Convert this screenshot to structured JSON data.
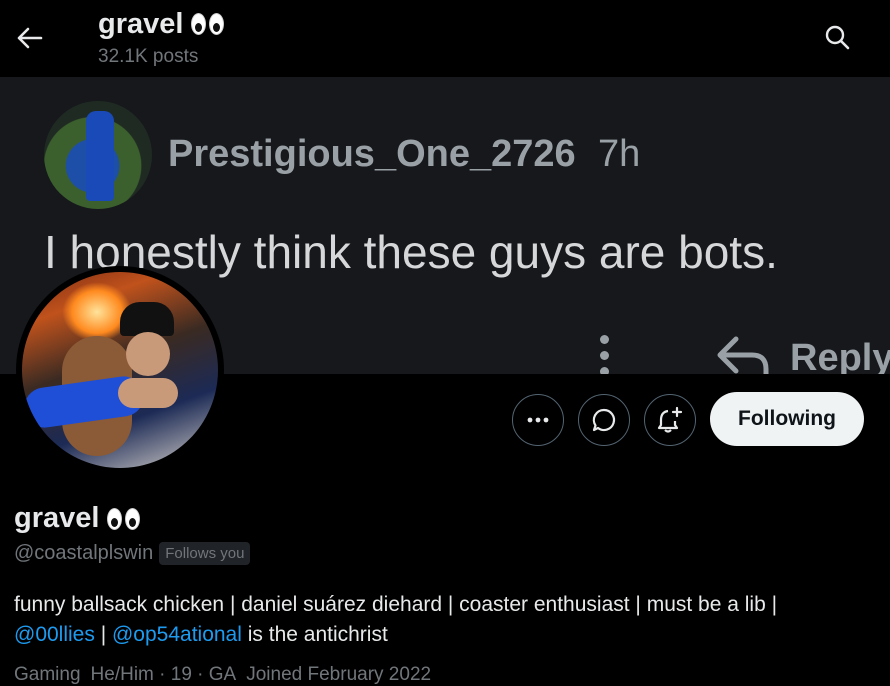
{
  "header": {
    "title": "gravel",
    "title_emoji": "eyes-emoji",
    "posts_count": "32.1K posts"
  },
  "banner": {
    "username": "Prestigious_One_2726",
    "time": "7h",
    "text": "I honestly think these guys are bots.",
    "reply_label": "Reply"
  },
  "profile": {
    "name": "gravel",
    "handle": "@coastalplswin",
    "follows_you": "Follows you",
    "following_label": "Following",
    "bio": {
      "part1": "funny ballsack chicken | daniel suárez diehard | coaster enthusiast | must be a lib |",
      "mention1": "@00llies",
      "sep": " | ",
      "mention2": "@op54ational",
      "part2": " is the antichrist"
    },
    "meta": {
      "category": "Gaming",
      "location": "He/Him · 19 · GA",
      "joined": "Joined February 2022"
    }
  },
  "colors": {
    "accent": "#1d9bf0",
    "background": "#000000",
    "muted": "#71767b"
  }
}
